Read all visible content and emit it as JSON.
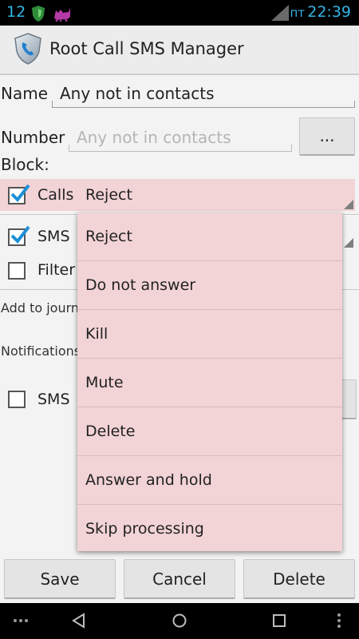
{
  "status_bar": {
    "notification_count": "12",
    "day": "пт",
    "time": "22:39"
  },
  "app": {
    "title": "Root Call SMS Manager"
  },
  "form": {
    "name_label": "Name",
    "name_value": "Any not in contacts",
    "number_label": "Number",
    "number_placeholder": "Any not in contacts",
    "number_picker_label": "...",
    "block_label": "Block:",
    "calls_label": "Calls",
    "calls_selected_action": "Reject",
    "sms_label": "SMS",
    "filter_label": "Filter",
    "add_to_journal_label": "Add to journa",
    "notifications_label": "Notifications",
    "sms_notification_label": "SMS"
  },
  "dropdown": {
    "items": [
      "Reject",
      "Do not answer",
      "Kill",
      "Mute",
      "Delete",
      "Answer and hold",
      "Skip processing"
    ]
  },
  "buttons": {
    "save": "Save",
    "cancel": "Cancel",
    "delete": "Delete"
  },
  "colors": {
    "accent": "#33b5e5",
    "selection_bg": "#f2d3d6",
    "check": "#1c8fd6"
  }
}
